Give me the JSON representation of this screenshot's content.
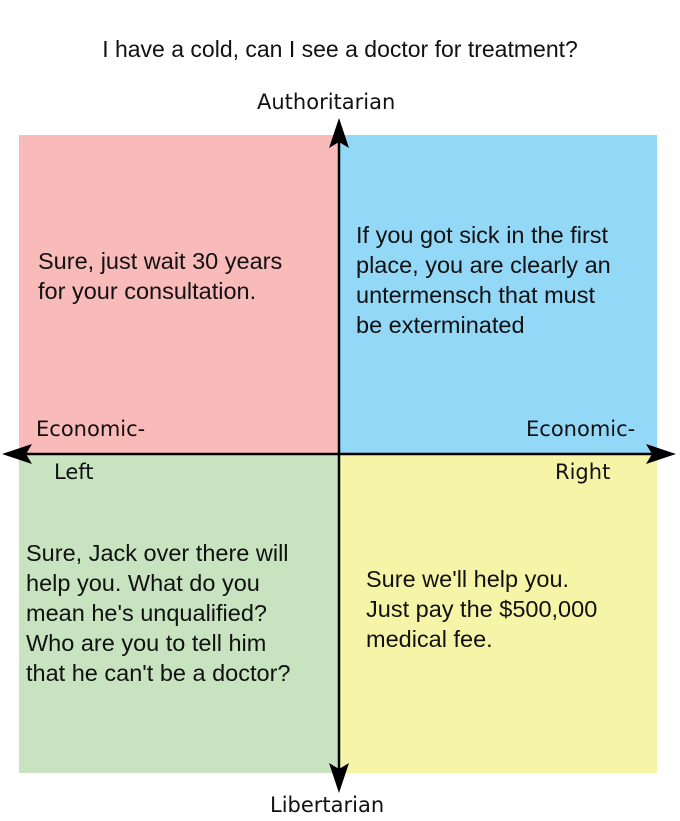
{
  "title": "I have a cold, can I see a doctor for treatment?",
  "axes": {
    "top": "Authoritarian",
    "bottom": "Libertarian",
    "left_line1": "Economic-",
    "left_line2": "Left",
    "right_line1": "Economic-",
    "right_line2": "Right"
  },
  "quadrants": {
    "auth_left": {
      "color": "#f9baba",
      "text": "Sure, just wait 30 years\nfor your consultation."
    },
    "auth_right": {
      "color": "#93d9f7",
      "text": "If you got sick in the first\nplace, you are clearly an\nuntermensch that must\nbe exterminated"
    },
    "lib_left": {
      "color": "#c8e3bf",
      "text": "Sure, Jack over there will\nhelp you. What do you\nmean he's unqualified?\nWho are you to tell him\nthat he can't be a doctor?"
    },
    "lib_right": {
      "color": "#f6f5a7",
      "text": "Sure we'll help you.\nJust pay the $500,000\nmedical fee."
    }
  }
}
